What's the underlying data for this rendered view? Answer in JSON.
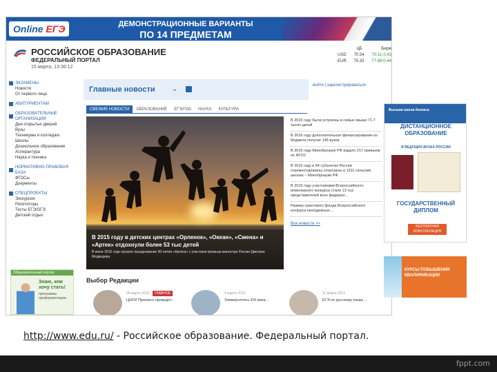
{
  "banner": {
    "logo_online": "Online",
    "logo_ege": "ЕГЭ",
    "title_line1": "ДЕМОНСТРАЦИОННЫЕ ВАРИАНТЫ",
    "title_line2": "ПО 14 ПРЕДМЕТАМ"
  },
  "portal": {
    "name": "РОССИЙСКОЕ ОБРАЗОВАНИЕ",
    "subtitle": "ФЕДЕРАЛЬНЫЙ ПОРТАЛ",
    "datetime": "15 марта, 13:36:12",
    "rates": [
      {
        "code": "USD",
        "cb": "70.54",
        "exch": "70.11-0.43"
      },
      {
        "code": "EUR",
        "cb": "75.33",
        "exch": "77.89-0.44"
      }
    ],
    "rates_headers": [
      "ЦБ",
      "Бирж"
    ]
  },
  "sidebar": {
    "sections": [
      {
        "title": "ЭКЗАМЕНЫ",
        "items": [
          "Новости",
          "От первого лица"
        ]
      },
      {
        "title": "АБИТУРИЕНТАМ",
        "items": []
      },
      {
        "title": "ОБРАЗОВАТЕЛЬНЫЕ ОРГАНИЗАЦИИ",
        "items": [
          "Дни открытых дверей",
          "Вузы",
          "Техникумы и колледжи",
          "Школы",
          "Дошкольное образование",
          "Аспирантура",
          "Наука и техника"
        ]
      },
      {
        "title": "НОРМАТИВНО-ПРАВОВАЯ БАЗА",
        "items": [
          "ФГОСы",
          "Документы"
        ]
      },
      {
        "title": "СПЕЦПРОЕКТЫ",
        "items": [
          "Экскурсии",
          "Репетиторы",
          "Тесты ЕГЭ/ОГЭ",
          "Детский отдых"
        ]
      }
    ],
    "ad_bar": "Образовательный портал",
    "ad_title": "Знаю, кем хочу стать!",
    "ad_text": "программы профориентации"
  },
  "main": {
    "news_title": "Главные новости",
    "login_text": "войти | зарегистрироваться",
    "tabs": [
      "СВЕЖИЕ НОВОСТИ",
      "ОБРАЗОВАНИЕ",
      "ЕГЭ/ГИА",
      "НАУКА",
      "КУЛЬТУРА"
    ],
    "photo_caption": "В 2015 году в детских центрах «Орленок», «Океан», «Смена» и «Артек» отдохнули более 53 тыс детей",
    "photo_subcaption": "В июне 2015 года прошло празднование 90-летия «Артека» с участием премьер-министра России Дмитрия Медведева",
    "news_items": [
      "В 2015 году были устроены в семьи свыше 71.7 тысяч детей",
      "В 2016 году дополнительное финансирование из бюджета получат 145 вузов",
      "В 2015 году Минобрнауки РФ издало 217 приказов по ФГОС",
      "В 2015 году в 54 субъектах России отремонтированы спортзалы в 1311 сельских школах – Минобрнауки РФ",
      "В 2015 году участниками Всероссийского инженерного конкурса стали 13 тыс представителей всех федерал...",
      "Размер грантового фонда Всероссийского конкурса молодежных..."
    ],
    "more_link": "Все новости >>",
    "editors_title": "Выбор Редакции",
    "editors": [
      {
        "date": "09 марта 2016",
        "badge": "ГЛАВНОЕ",
        "text": "ЦНТИ Прогресс проведет..."
      },
      {
        "date": "9 марта 2016",
        "badge": "",
        "text": "Университеты XXI века..."
      },
      {
        "date": "11 марта 2016",
        "badge": "",
        "text": "ЕГЭ по русскому языку ..."
      }
    ]
  },
  "ads": {
    "ad1_logo": "Высшая школа бизнеса",
    "ad1_heading": "ДИСТАНЦИОННОЕ ОБРАЗОВАНИЕ",
    "ad1_sub": "В ВЕДУЩИХ ВУЗАХ РОССИИ",
    "ad1_heading2": "ГОСУДАРСТВЕННЫЙ ДИПЛОМ",
    "ad1_button": "БЕСПЛАТНАЯ КОНСУЛЬТАЦИЯ",
    "ad2_text": "КУРСЫ ПОВЫШЕНИЯ КВАЛИФИКАЦИИ"
  },
  "caption": {
    "link": "http://www.edu.ru/",
    "text": " - Российское образование. Федеральный портал."
  },
  "footer": {
    "brand": "fppt.com"
  },
  "colors": {
    "brand_blue": "#2a64a8",
    "banner_blue": "#1e5aa8",
    "accent_red": "#c43a3a",
    "ad_orange": "#e8742b"
  }
}
